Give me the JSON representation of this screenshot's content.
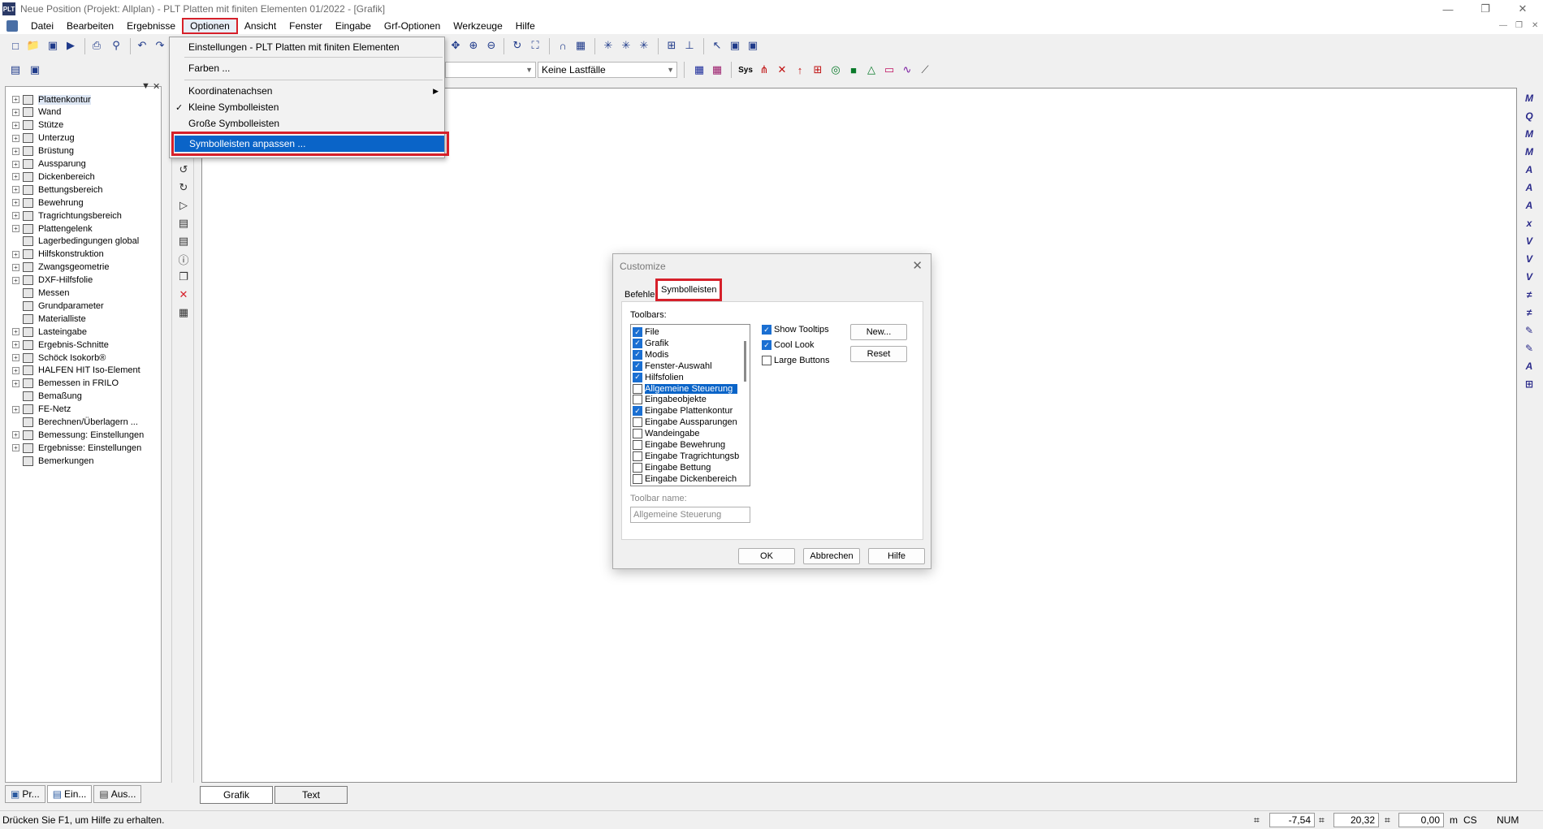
{
  "window": {
    "title": "Neue Position (Projekt: Allplan) - PLT Platten mit finiten Elementen 01/2022 - [Grafik]",
    "app_icon_text": "PLT"
  },
  "menubar": {
    "items": [
      "Datei",
      "Bearbeiten",
      "Ergebnisse",
      "Optionen",
      "Ansicht",
      "Fenster",
      "Eingabe",
      "Grf-Optionen",
      "Werkzeuge",
      "Hilfe"
    ]
  },
  "toolbar": {
    "loadcase_combo": "Keine Lastfälle",
    "sys_label": "Sys"
  },
  "dropdown": {
    "items": [
      {
        "label": "Einstellungen - PLT Platten mit finiten Elementen",
        "check": ""
      },
      {
        "label": "Farben ...",
        "check": ""
      },
      {
        "label": "Koordinatenachsen",
        "check": "",
        "submenu": "▶"
      },
      {
        "label": "Kleine Symbolleisten",
        "check": "✓"
      },
      {
        "label": "Große Symbolleisten",
        "check": ""
      },
      {
        "label": "Symbolleisten anpassen ...",
        "check": ""
      }
    ]
  },
  "tree": {
    "items": [
      {
        "label": "Plattenkontur",
        "expander": "+",
        "selected": true
      },
      {
        "label": "Wand",
        "expander": "+"
      },
      {
        "label": "Stütze",
        "expander": "+"
      },
      {
        "label": "Unterzug",
        "expander": "+"
      },
      {
        "label": "Brüstung",
        "expander": "+"
      },
      {
        "label": "Aussparung",
        "expander": "+"
      },
      {
        "label": "Dickenbereich",
        "expander": "+"
      },
      {
        "label": "Bettungsbereich",
        "expander": "+"
      },
      {
        "label": "Bewehrung",
        "expander": "+"
      },
      {
        "label": "Tragrichtungsbereich",
        "expander": "+"
      },
      {
        "label": "Plattengelenk",
        "expander": "+"
      },
      {
        "label": "Lagerbedingungen global",
        "expander": ""
      },
      {
        "label": "Hilfskonstruktion",
        "expander": "+"
      },
      {
        "label": "Zwangsgeometrie",
        "expander": "+"
      },
      {
        "label": "DXF-Hilfsfolie",
        "expander": "+"
      },
      {
        "label": "Messen",
        "expander": ""
      },
      {
        "label": "Grundparameter",
        "expander": ""
      },
      {
        "label": "Materialliste",
        "expander": ""
      },
      {
        "label": "Lasteingabe",
        "expander": "+"
      },
      {
        "label": "Ergebnis-Schnitte",
        "expander": "+"
      },
      {
        "label": "Schöck Isokorb®",
        "expander": "+"
      },
      {
        "label": "HALFEN HIT Iso-Element",
        "expander": "+"
      },
      {
        "label": "Bemessen in FRILO",
        "expander": "+"
      },
      {
        "label": "Bemaßung",
        "expander": ""
      },
      {
        "label": "FE-Netz",
        "expander": "+"
      },
      {
        "label": "Berechnen/Überlagern ...",
        "expander": ""
      },
      {
        "label": "Bemessung: Einstellungen",
        "expander": "+"
      },
      {
        "label": "Ergebnisse: Einstellungen",
        "expander": "+"
      },
      {
        "label": "Bemerkungen",
        "expander": ""
      }
    ]
  },
  "panel_tabs": [
    "Pr...",
    "Ein...",
    "Aus..."
  ],
  "bottom_tabs": [
    "Grafik",
    "Text"
  ],
  "right_toolbar": [
    "M",
    "Q",
    "M",
    "M",
    "A",
    "A",
    "A",
    "x",
    "V",
    "V",
    "V",
    "≠",
    "≠",
    "✎",
    "✎",
    "A",
    "⊞"
  ],
  "status": {
    "help_text": "Drücken Sie F1, um Hilfe zu erhalten.",
    "x_value": "-7,54",
    "y_value": "20,32",
    "z_value": "0,00",
    "unit": "m",
    "cs": "CS",
    "num": "NUM"
  },
  "dialog": {
    "title": "Customize",
    "tabs": [
      "Befehle",
      "Symbolleisten"
    ],
    "toolbars_label": "Toolbars:",
    "toolbars": [
      {
        "label": "File",
        "checked": true
      },
      {
        "label": "Grafik",
        "checked": true
      },
      {
        "label": "Modis",
        "checked": true
      },
      {
        "label": "Fenster-Auswahl",
        "checked": true
      },
      {
        "label": "Hilfsfolien",
        "checked": true
      },
      {
        "label": "Allgemeine Steuerung",
        "checked": false,
        "selected": true
      },
      {
        "label": "Eingabeobjekte",
        "checked": false
      },
      {
        "label": "Eingabe Plattenkontur",
        "checked": true
      },
      {
        "label": "Eingabe Aussparungen",
        "checked": false
      },
      {
        "label": "Wandeingabe",
        "checked": false
      },
      {
        "label": "Eingabe Bewehrung",
        "checked": false
      },
      {
        "label": "Eingabe Tragrichtungsb",
        "checked": false
      },
      {
        "label": "Eingabe Bettung",
        "checked": false
      },
      {
        "label": "Eingabe Dickenbereich",
        "checked": false
      }
    ],
    "options": [
      {
        "label": "Show Tooltips",
        "checked": true
      },
      {
        "label": "Cool Look",
        "checked": true
      },
      {
        "label": "Large Buttons",
        "checked": false
      }
    ],
    "new_button": "New...",
    "reset_button": "Reset",
    "toolbar_name_label": "Toolbar name:",
    "toolbar_name_value": "Allgemeine Steuerung",
    "ok_button": "OK",
    "cancel_button": "Abbrechen",
    "help_button": "Hilfe"
  },
  "colors": {
    "highlight_red": "#d6202a",
    "selection_blue": "#0a64c8",
    "checkbox_blue": "#1a6fd2"
  }
}
